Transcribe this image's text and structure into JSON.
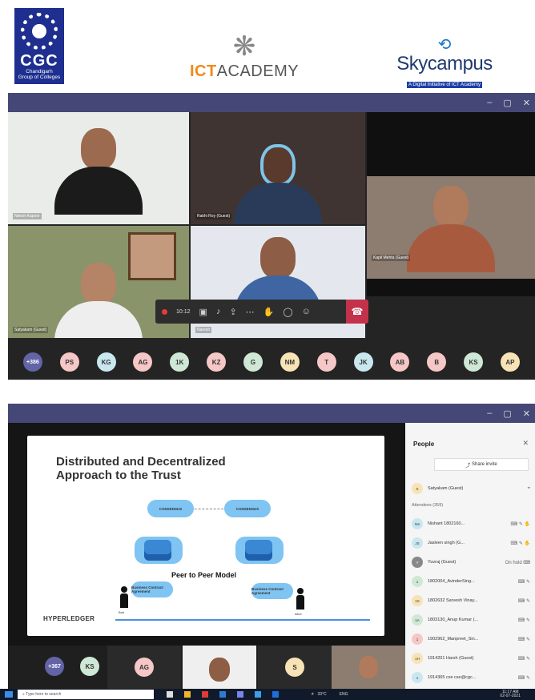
{
  "logos": {
    "cgc": {
      "name": "CGC",
      "sub1": "Chandigarh",
      "sub2": "Group of Colleges"
    },
    "ict": {
      "prefix": "ICT",
      "rest": "ACADEMY"
    },
    "sky": {
      "name": "Skycampus",
      "tag": "A Digital Initiative of ICT Academy"
    }
  },
  "window1": {
    "controls": {
      "minimize": "–",
      "maximize": "▢",
      "close": "✕"
    },
    "tiles": [
      {
        "label": "Nitesh Kapoor"
      },
      {
        "label": "Rakhi Roy (Guest)"
      },
      {
        "label": "Kapil Mehta (Guest)"
      },
      {
        "label": "Satyakam (Guest)"
      },
      {
        "label": "Naresh"
      }
    ],
    "call_timer": "10:12",
    "avatars": [
      {
        "initials": "+386",
        "color": "#6264a7"
      },
      {
        "initials": "PS",
        "color": "#f6c7c7"
      },
      {
        "initials": "KG",
        "color": "#c9e7ef"
      },
      {
        "initials": "AG",
        "color": "#f6c7c7"
      },
      {
        "initials": "1K",
        "color": "#cfe8d6"
      },
      {
        "initials": "KZ",
        "color": "#f6c7c7"
      },
      {
        "initials": "G",
        "color": "#cfe8d6"
      },
      {
        "initials": "NM",
        "color": "#f7e3b5"
      },
      {
        "initials": "T",
        "color": "#f6c7c7"
      },
      {
        "initials": "JK",
        "color": "#c9e7ef"
      },
      {
        "initials": "AB",
        "color": "#f6c7c7"
      },
      {
        "initials": "B",
        "color": "#f6c7c7"
      },
      {
        "initials": "KS",
        "color": "#cfe8d6"
      },
      {
        "initials": "AP",
        "color": "#f7e3b5"
      }
    ]
  },
  "window2": {
    "controls": {
      "minimize": "–",
      "maximize": "▢",
      "close": "✕"
    },
    "slide": {
      "title_line1": "Distributed and Decentralized",
      "title_line2": "Approach to the Trust",
      "cloud_left": "CONSENSUS",
      "cloud_right": "CONSENSUS",
      "model_label": "Peer to Peer Model",
      "node_left": "Business Contract Agreement",
      "node_right": "Business Contract Agreement",
      "person_left": "Bob",
      "person_right": "Alice",
      "brand": "HYPERLEDGER"
    },
    "people_panel": {
      "title": "People",
      "close": "✕",
      "share_invite": "Share invite",
      "presenter": {
        "initials": "S",
        "name": "Satyakam (Guest)",
        "color": "#f7e3b5"
      },
      "attendees_header": "Attendees (359)",
      "attendees": [
        {
          "initials": "NS",
          "name": "Nishant 1802160...",
          "color": "#c9e7ef",
          "status": "⌨ ✎ ✋"
        },
        {
          "initials": "JS",
          "name": "Jasleen singh (G...",
          "color": "#c9e7ef",
          "status": "⌨ ✎ ✋"
        },
        {
          "initials": "Y",
          "name": "Yuvraj (Guest)",
          "color": "#888888",
          "status": "On hold ⌨"
        },
        {
          "initials": "1",
          "name": "1802004_AvinderSing...",
          "color": "#cfe8d6",
          "status": "⌨ ✎"
        },
        {
          "initials": "1S",
          "name": "1802632 Sarvesh Vinay...",
          "color": "#f7e3b5",
          "status": "⌨ ✎"
        },
        {
          "initials": "1A",
          "name": "1803130_Anup Kumar (...",
          "color": "#cfe8d6",
          "status": "⌨ ✎"
        },
        {
          "initials": "1",
          "name": "1902962_Manpreet_Sin...",
          "color": "#f6c7c7",
          "status": "⌨ ✎"
        },
        {
          "initials": "1H",
          "name": "1914201 Harsh (Guest)",
          "color": "#f7e3b5",
          "status": "⌨ ✎"
        },
        {
          "initials": "1",
          "name": "1914365 cse cse@cgc...",
          "color": "#c9e7ef",
          "status": "⌨ ✎"
        }
      ]
    },
    "bottom_avatars": [
      {
        "initials": "+367",
        "color": "#6264a7"
      },
      {
        "initials": "KS",
        "color": "#cfe8d6"
      },
      {
        "initials": "AG",
        "color": "#f6c7c7"
      },
      {
        "initials": "S",
        "color": "#f7e3b5"
      }
    ]
  },
  "taskbar": {
    "search_placeholder": "Type here to search",
    "temperature": "33°C",
    "language": "ENG",
    "time": "11:17 AM",
    "date": "02-07-2021"
  }
}
